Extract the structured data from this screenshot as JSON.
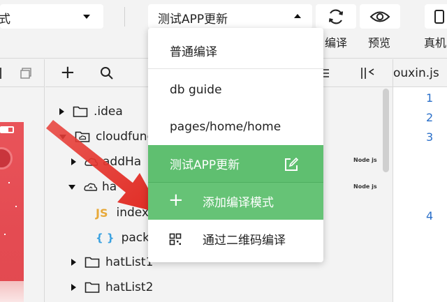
{
  "toolbar": {
    "mode_value": "式",
    "compile_value": "测试APP更新",
    "compile_label": "编译",
    "preview_label": "预览",
    "device_label": "真机"
  },
  "explorer": {
    "tree": [
      {
        "label": ".idea",
        "kind": "folder",
        "state": "collapsed"
      },
      {
        "label": "cloudfunc",
        "kind": "cloud-folder",
        "state": "expanded"
      },
      {
        "label": "addHa",
        "kind": "cloud-function",
        "state": "collapsed",
        "badge": "Node js"
      },
      {
        "label": "ha",
        "kind": "cloud-function",
        "state": "expanded",
        "badge": "Node js"
      },
      {
        "label": "index",
        "kind": "js-file",
        "icon_text": "JS"
      },
      {
        "label": "pack",
        "kind": "json-file",
        "icon_text": "{ }"
      },
      {
        "label": "hatList1",
        "kind": "folder",
        "state": "collapsed"
      },
      {
        "label": "hatList2",
        "kind": "folder",
        "state": "collapsed"
      }
    ]
  },
  "editor": {
    "tab_label": "ouxin.js",
    "line_numbers": [
      "1",
      "2",
      "3",
      "4"
    ]
  },
  "dropdown": {
    "items": [
      {
        "label": "普通编译"
      },
      {
        "label": "db guide"
      },
      {
        "label": "pages/home/home"
      },
      {
        "label": "测试APP更新",
        "selected": true
      },
      {
        "label": "添加编译模式"
      },
      {
        "label": "通过二维码编译"
      }
    ]
  },
  "colors": {
    "accent_green": "#5fbf70",
    "arrow_red": "#e8403a",
    "line_number_blue": "#2a6fc9"
  }
}
